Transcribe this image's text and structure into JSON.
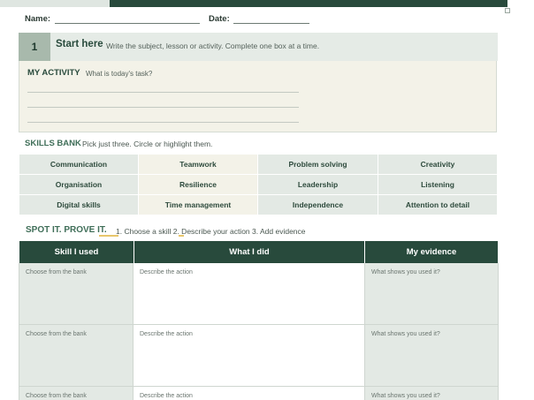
{
  "header": {
    "name_label": "Name:",
    "date_label": "Date:"
  },
  "start": {
    "step_number": "1",
    "title": "Start here",
    "description": "Write the subject, lesson or activity. Complete one box at a time."
  },
  "activity": {
    "title": "MY ACTIVITY",
    "prompt": "What is today's task?"
  },
  "skills_bank": {
    "title": "SKILLS BANK",
    "description": "Pick just three. Circle or highlight them.",
    "rows": [
      [
        "Communication",
        "Teamwork",
        "Problem solving",
        "Creativity"
      ],
      [
        "Organisation",
        "Resilience",
        "Leadership",
        "Listening"
      ],
      [
        "Digital skills",
        "Time management",
        "Independence",
        "Attention to detail"
      ]
    ]
  },
  "spot_it": {
    "title": "SPOT IT. PROVE IT.",
    "steps": "1. Choose a skill  2. Describe your action  3. Add evidence"
  },
  "evidence_table": {
    "headers": [
      "Skill I used",
      "What I did",
      "My evidence"
    ],
    "rows": [
      [
        "Choose from the bank",
        "Describe the action",
        "What shows you used it?"
      ],
      [
        "Choose from the bank",
        "Describe the action",
        "What shows you used it?"
      ],
      [
        "Choose from the bank",
        "Describe the action",
        "What shows you used it?"
      ]
    ]
  },
  "colors": {
    "dark_green": "#284a3c",
    "sage": "#a8b9ac",
    "light_green": "#e3e9e4",
    "cream": "#f3f2e8",
    "accent_green": "#3f6e58",
    "highlight": "#e8c66c"
  }
}
